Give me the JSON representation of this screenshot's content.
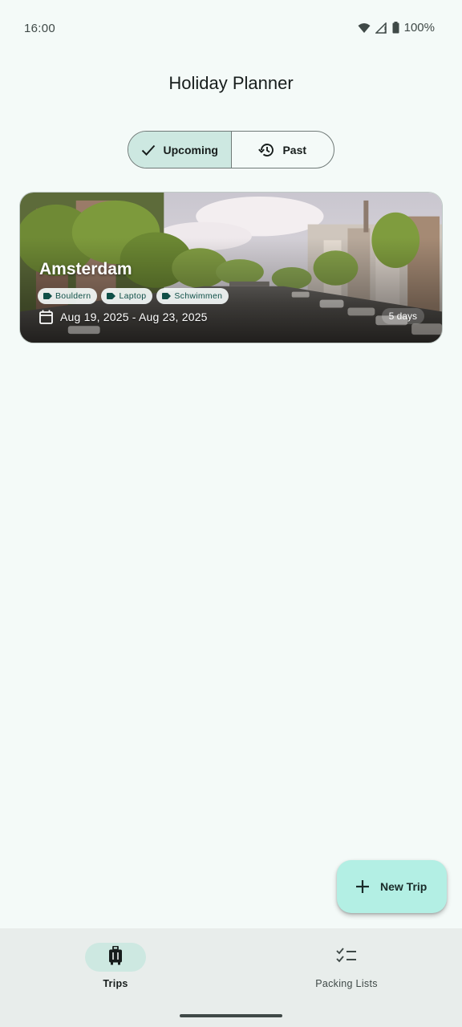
{
  "status_bar": {
    "time": "16:00",
    "battery": "100%",
    "icons": [
      "wifi-icon",
      "signal-icon",
      "battery-icon"
    ]
  },
  "app": {
    "title": "Holiday Planner"
  },
  "segments": [
    {
      "label": "Upcoming",
      "icon": "check-icon",
      "selected": true
    },
    {
      "label": "Past",
      "icon": "history-icon",
      "selected": false
    }
  ],
  "trips": [
    {
      "title": "Amsterdam",
      "tags": [
        "Bouldern",
        "Laptop",
        "Schwimmen"
      ],
      "dates": "Aug 19, 2025 - Aug 23, 2025",
      "duration": "5 days"
    }
  ],
  "fab": {
    "label": "New Trip",
    "icon": "plus-icon"
  },
  "bottom_nav": {
    "items": [
      {
        "label": "Trips",
        "icon": "luggage-icon",
        "active": true
      },
      {
        "label": "Packing Lists",
        "icon": "checklist-icon",
        "active": false
      }
    ]
  },
  "colors": {
    "background": "#f4faf8",
    "segment_selected": "#cde8e1",
    "fab": "#b3efe4",
    "nav_bar": "#e8edeb",
    "chip_text": "#0f4f47"
  }
}
